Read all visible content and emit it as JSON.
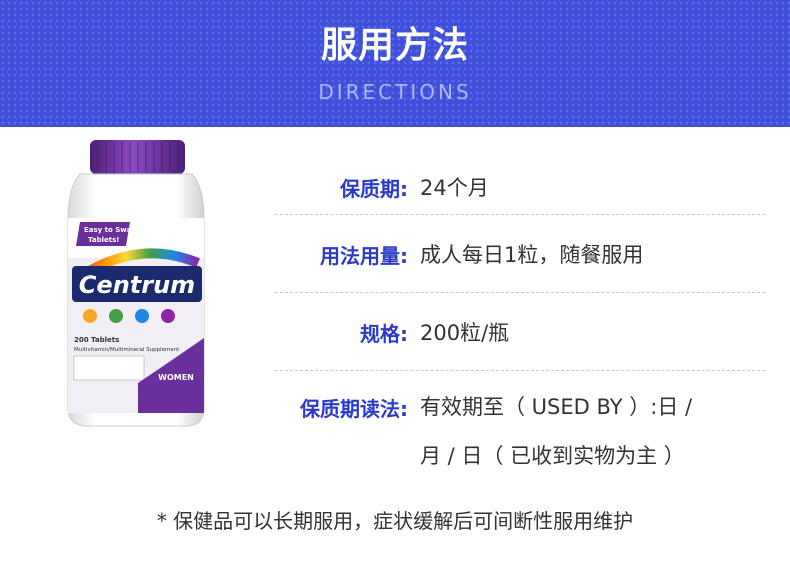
{
  "header": {
    "title": "服用方法",
    "subtitle": "DIRECTIONS",
    "background_color": "#3e4fdc"
  },
  "product": {
    "brand": "Centrum",
    "badge": "Easy to Swallow Tablets!",
    "count": "200 Tablets",
    "description": "Multivitamin/Multimineral Supplement",
    "variant": "WOMEN",
    "cap_color": "#6a2f9b"
  },
  "details": [
    {
      "label": "保质期:",
      "value": "24个月"
    },
    {
      "label": "用法用量:",
      "value": "成人每日1粒，随餐服用"
    },
    {
      "label": "规格:",
      "value": "200粒/瓶"
    },
    {
      "label": "保质期读法:",
      "value_line1": "有效期至（ USED BY ）:日 /",
      "value_line2": "月 / 日（ 已收到实物为主 ）"
    }
  ],
  "note": "* 保健品可以长期服用，症状缓解后可间断性服用维护",
  "colors": {
    "label": "#2c3ac9",
    "value": "#333333"
  }
}
